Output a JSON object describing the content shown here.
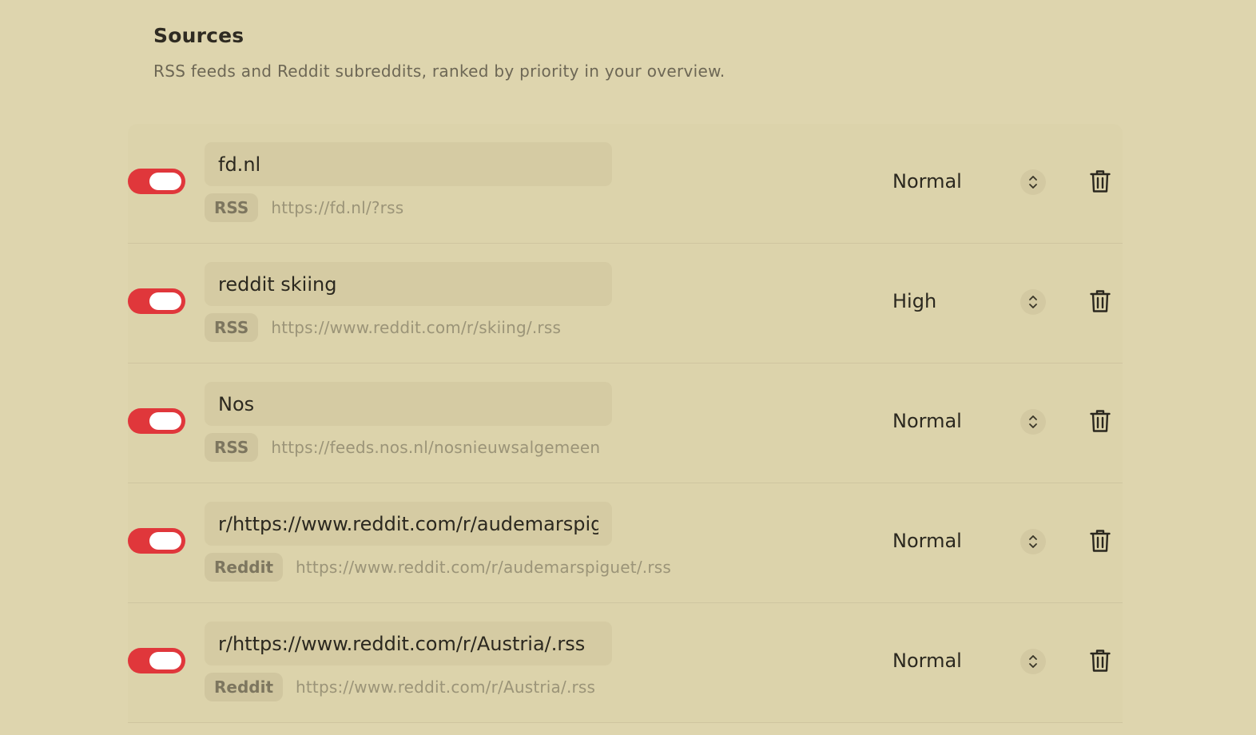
{
  "header": {
    "title": "Sources",
    "subtitle": "RSS feeds and Reddit subreddits, ranked by priority in your overview."
  },
  "colors": {
    "background": "#ded5ae",
    "toggle_on": "#e0373b",
    "field_bg": "#d5cba3",
    "badge_bg": "#d0c69f"
  },
  "icons": {
    "toggle": "toggle-switch-icon",
    "stepper": "chevron-up-down-icon",
    "delete": "trash-icon"
  },
  "sources": [
    {
      "enabled": true,
      "name": "fd.nl",
      "type": "RSS",
      "url": "https://fd.nl/?rss",
      "priority": "Normal"
    },
    {
      "enabled": true,
      "name": "reddit skiing",
      "type": "RSS",
      "url": "https://www.reddit.com/r/skiing/.rss",
      "priority": "High"
    },
    {
      "enabled": true,
      "name": "Nos",
      "type": "RSS",
      "url": "https://feeds.nos.nl/nosnieuwsalgemeen",
      "priority": "Normal"
    },
    {
      "enabled": true,
      "name": "r/https://www.reddit.com/r/audemarspiguet/.rss",
      "type": "Reddit",
      "url": "https://www.reddit.com/r/audemarspiguet/.rss",
      "priority": "Normal"
    },
    {
      "enabled": true,
      "name": "r/https://www.reddit.com/r/Austria/.rss",
      "type": "Reddit",
      "url": "https://www.reddit.com/r/Austria/.rss",
      "priority": "Normal"
    }
  ]
}
